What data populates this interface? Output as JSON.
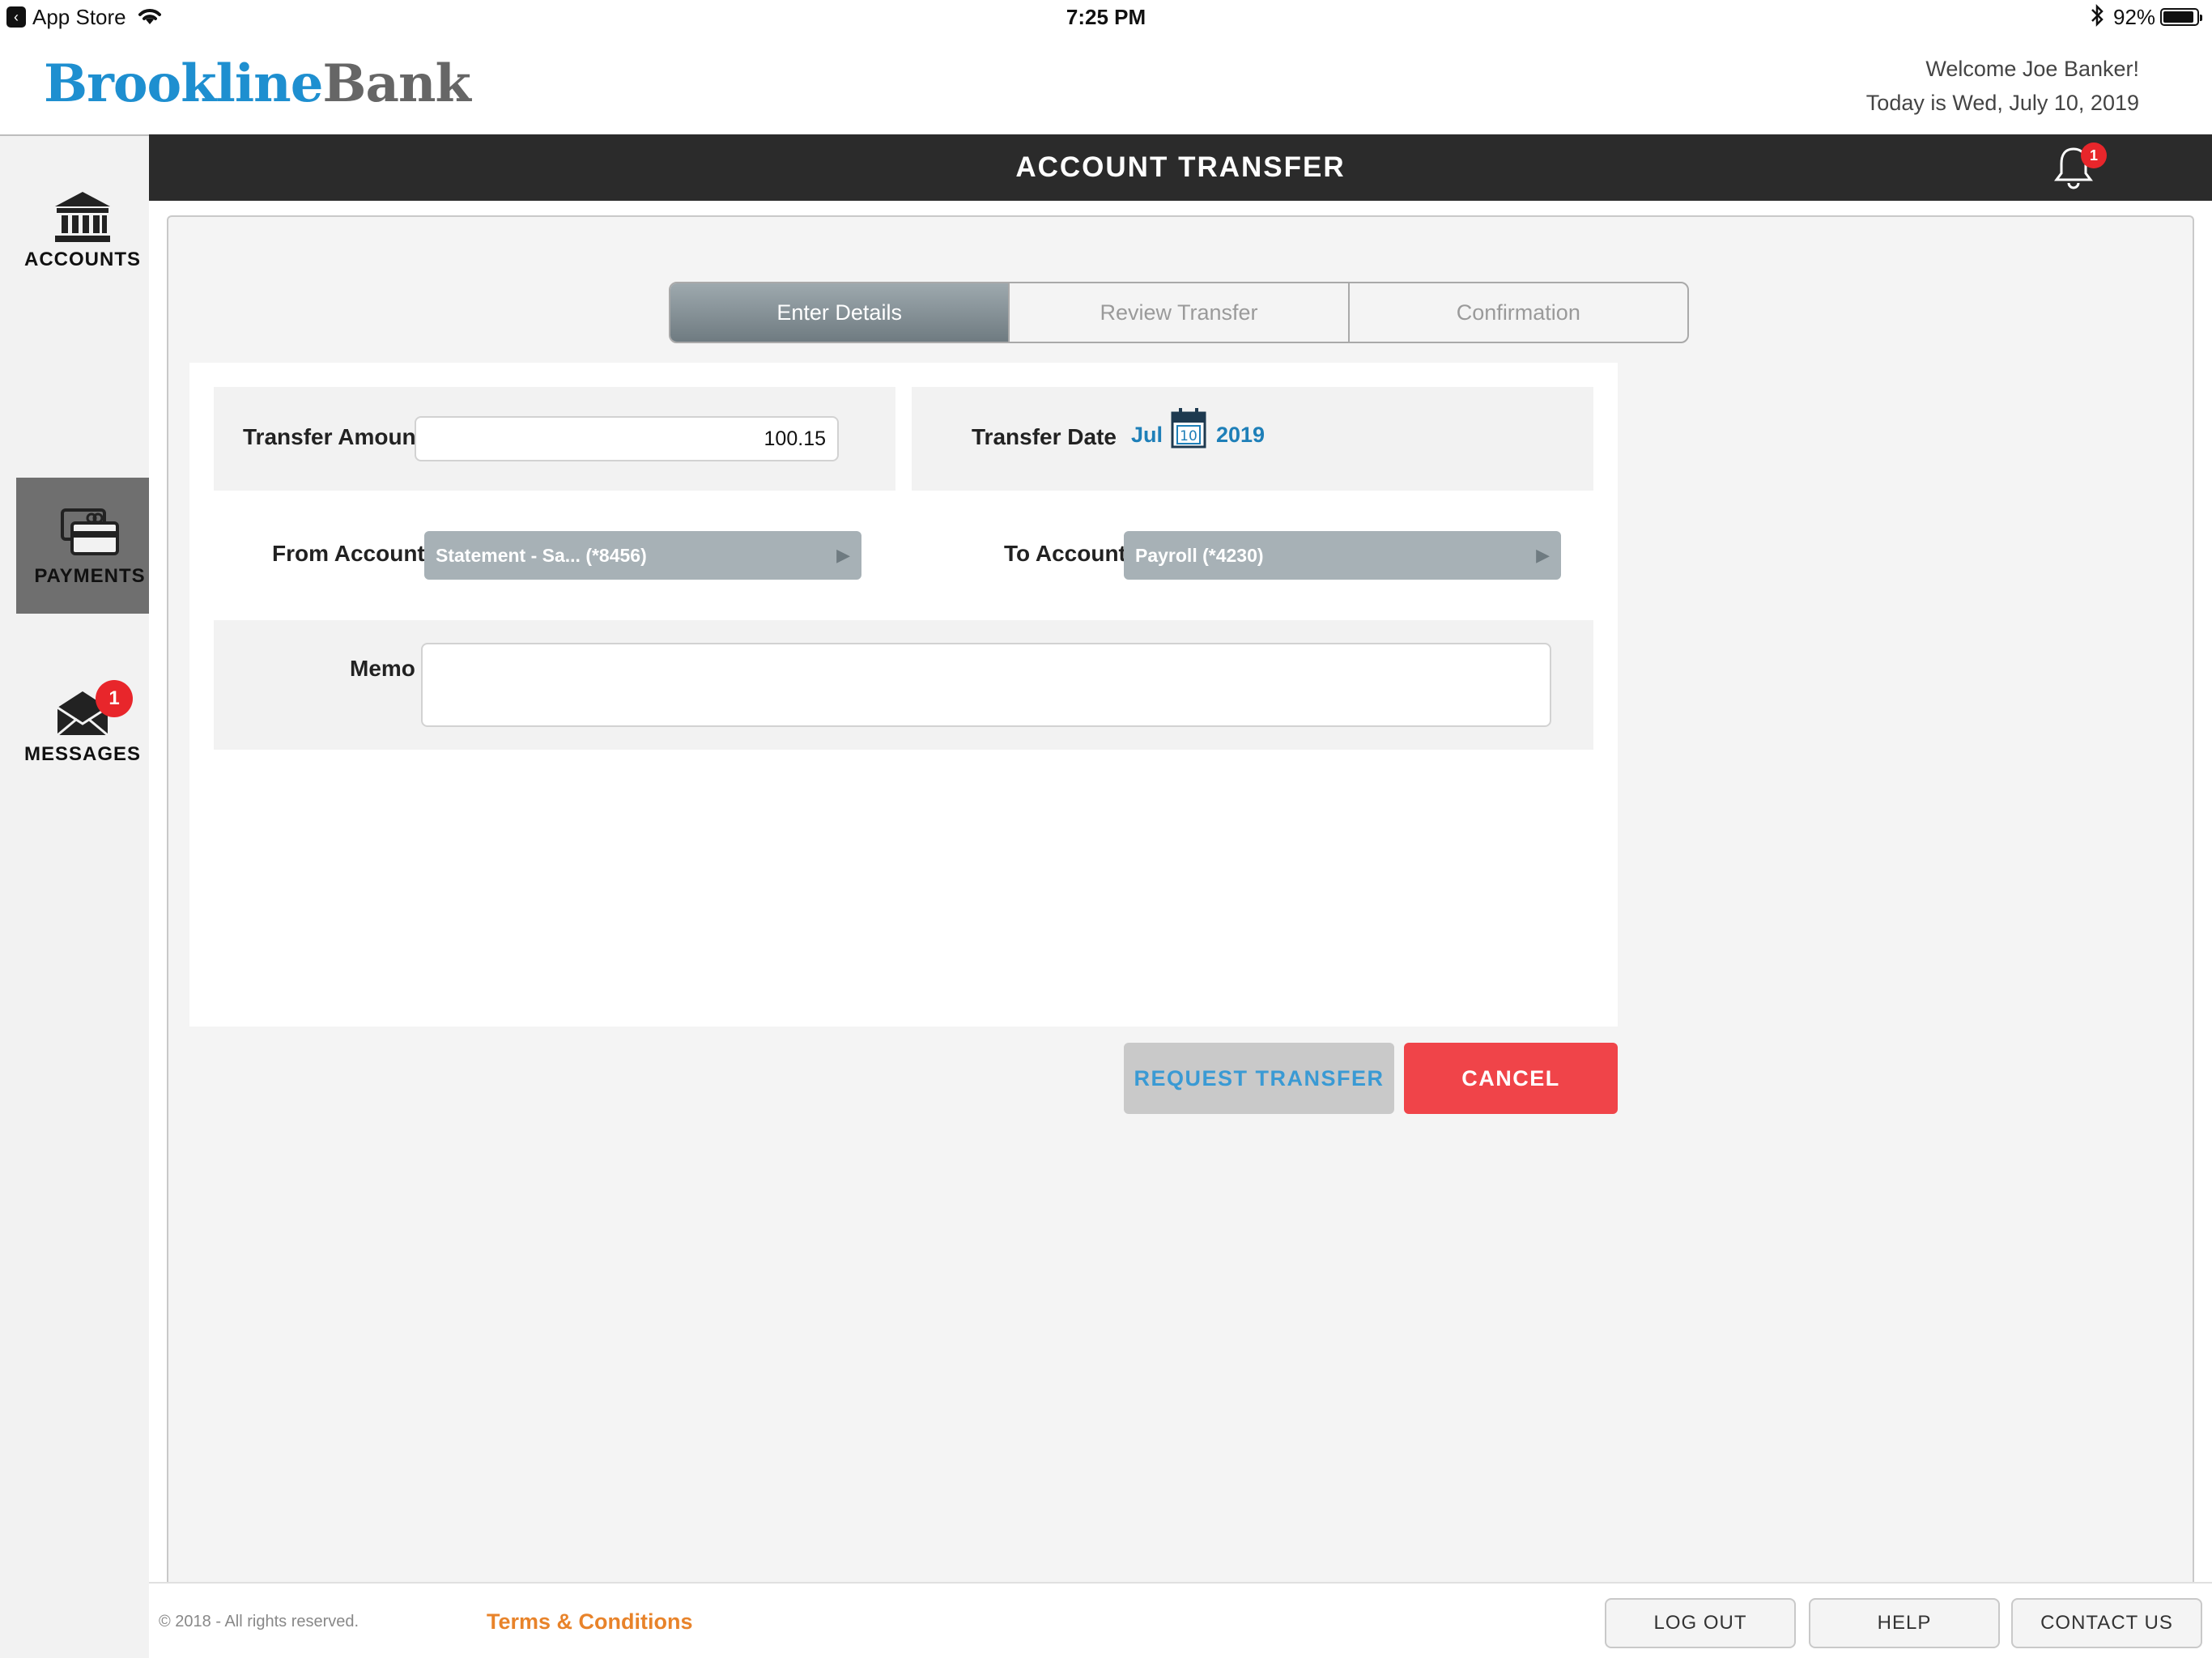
{
  "status_bar": {
    "back_app": "App Store",
    "time": "7:25 PM",
    "battery": "92%",
    "battery_level": 0.92
  },
  "header": {
    "brand_part1": "Brookline",
    "brand_part2": "Bank",
    "welcome": "Welcome Joe Banker!",
    "today": "Today is Wed, July 10, 2019"
  },
  "sidebar": {
    "items": [
      {
        "label": "ACCOUNTS",
        "icon": "bank-icon"
      },
      {
        "label": "PAYMENTS",
        "icon": "payment-card-icon",
        "active": true
      },
      {
        "label": "MESSAGES",
        "icon": "envelope-icon",
        "badge": "1"
      }
    ]
  },
  "title_bar": {
    "title": "ACCOUNT TRANSFER",
    "notifications_badge": "1"
  },
  "stepper": {
    "steps": [
      "Enter Details",
      "Review Transfer",
      "Confirmation"
    ],
    "active_index": 0
  },
  "form": {
    "amount_label": "Transfer Amount",
    "amount_value": "100.15",
    "date_label": "Transfer Date",
    "date_month": "Jul",
    "date_day": "10",
    "date_year": "2019",
    "from_label": "From Account",
    "from_value": "Statement - Sa...  (*8456)",
    "to_label": "To Account",
    "to_value": "Payroll (*4230)",
    "memo_label": "Memo",
    "memo_value": ""
  },
  "actions": {
    "request": "REQUEST TRANSFER",
    "cancel": "CANCEL"
  },
  "footer": {
    "copyright": "© 2018 - All rights reserved.",
    "terms": "Terms & Conditions",
    "logout": "LOG OUT",
    "help": "HELP",
    "contact": "CONTACT US"
  },
  "colors": {
    "brand_blue": "#1e8fd0",
    "cancel_red": "#f04449",
    "badge_red": "#e8262b",
    "title_bar": "#2b2b2b",
    "terms_orange": "#e8832a"
  }
}
